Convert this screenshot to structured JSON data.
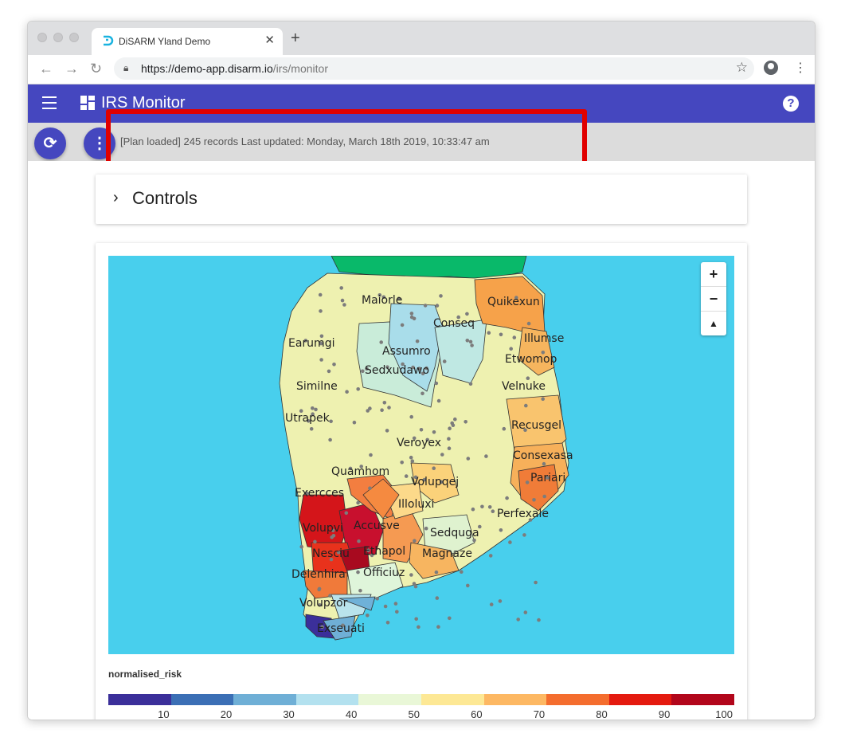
{
  "browser": {
    "tab_title": "DiSARM Yland Demo",
    "close_icon": "close-icon",
    "new_tab_icon": "plus-icon",
    "url_host": "https://demo-app.disarm.io",
    "url_path": "/irs/monitor"
  },
  "app": {
    "title": "IRS Monitor",
    "brand_color": "#4547bf",
    "icons": [
      "hamburger-menu-icon",
      "dashboard-icon",
      "help-icon"
    ]
  },
  "status": {
    "text": "[Plan loaded] 245 records Last updated: Monday, March 18th 2019, 10:33:47 am",
    "refresh_icon": "refresh-icon",
    "more_icon": "more-vertical-icon"
  },
  "controls": {
    "label": "Controls"
  },
  "map": {
    "zoom_in": "+",
    "zoom_out": "−",
    "compass": "▲",
    "places": [
      "Maiorle",
      "Quikexun",
      "Conseq",
      "Earumgi",
      "Illumse",
      "Assumro",
      "Etwomop",
      "Sedxudawo",
      "Similne",
      "Velnuke",
      "Utrapek",
      "Recusgel",
      "Veroyex",
      "Consexasa",
      "Quamhom",
      "Pariari",
      "Volupqej",
      "Exercces",
      "Illoluxi",
      "Perfexale",
      "Volupvi",
      "Accusve",
      "Sedquga",
      "Nesciu",
      "Ethapol",
      "Magnaze",
      "Delenhira",
      "Officiuz",
      "Volupzor",
      "Exseuati"
    ]
  },
  "legend": {
    "title": "normalised_risk",
    "labels": [
      "10",
      "20",
      "30",
      "40",
      "50",
      "60",
      "70",
      "80",
      "90",
      "100"
    ],
    "colors": [
      "#3b2f9a",
      "#3b6fb5",
      "#6fafd6",
      "#b3e1ef",
      "#e9f7d7",
      "#fde895",
      "#fdb863",
      "#f46d2e",
      "#e41a0f",
      "#b2061b"
    ]
  }
}
